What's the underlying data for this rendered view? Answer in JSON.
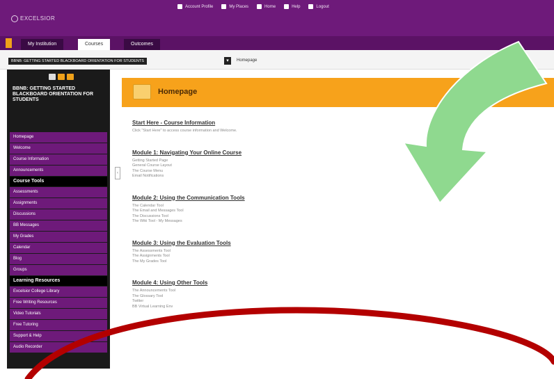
{
  "topbar": {
    "logo_text": "EXCELSIOR",
    "links": [
      {
        "icon": "user-icon",
        "label": "Account Profile"
      },
      {
        "icon": "home-icon",
        "label": "My Places"
      },
      {
        "icon": "house-icon",
        "label": "Home"
      },
      {
        "icon": "help-icon",
        "label": "Help"
      },
      {
        "icon": "logout-icon",
        "label": "Logout"
      }
    ]
  },
  "tabs": [
    {
      "label": "My Institution"
    },
    {
      "label": "Courses"
    },
    {
      "label": "Outcomes"
    }
  ],
  "breadcrumb": {
    "course": "BBNB: GETTING STARTED BLACKBOARD ORIENTATION FOR STUDENTS",
    "current": "Homepage"
  },
  "sidebar": {
    "course_title": "BBNB: GETTING STARTED BLACKBOARD ORIENTATION FOR STUDENTS",
    "items": [
      "Homepage",
      "Welcome",
      "Course Information",
      "Announcements"
    ],
    "section_course_tools": "Course Tools",
    "course_tools": [
      "Assessments",
      "Assignments",
      "Discussions",
      "BB Messages",
      "My Grades",
      "Calendar",
      "Blog",
      "Groups"
    ],
    "section_learning": "Learning Resources",
    "learning_resources": [
      "Excelsior College Library",
      "Free Writing Resources",
      "Video Tutorials",
      "Free Tutoring",
      "Support & Help",
      "Audio Recorder"
    ]
  },
  "main": {
    "page_title": "Homepage",
    "modules": [
      {
        "title": "Start Here - Course Information",
        "lines": [
          "Click \"Start Here\" to access course information and Welcome."
        ]
      },
      {
        "title": "Module 1: Navigating Your Online Course",
        "lines": [
          "Getting Started Page",
          "General Course Layout",
          "The Course Menu",
          "Email Notifications"
        ]
      },
      {
        "title": "Module 2: Using the Communication Tools",
        "lines": [
          "The Calendar Tool",
          "The Email and Messages Tool",
          "The Discussions Tool",
          "The Wiki Tool - My Messages"
        ]
      },
      {
        "title": "Module 3: Using the Evaluation Tools",
        "lines": [
          "The Assessments Tool",
          "The Assignments Tool",
          "The My Grades Tool"
        ]
      },
      {
        "title": "Module 4: Using Other Tools",
        "lines": [
          "The Announcements Tool",
          "The Glossary Tool",
          "Twitter",
          "BB Virtual Learning Env"
        ]
      }
    ]
  },
  "colors": {
    "brand_purple": "#6e1a7a",
    "header_orange": "#f7a21b",
    "arrow_green": "#8fd98f",
    "circle_red": "#b30000"
  }
}
